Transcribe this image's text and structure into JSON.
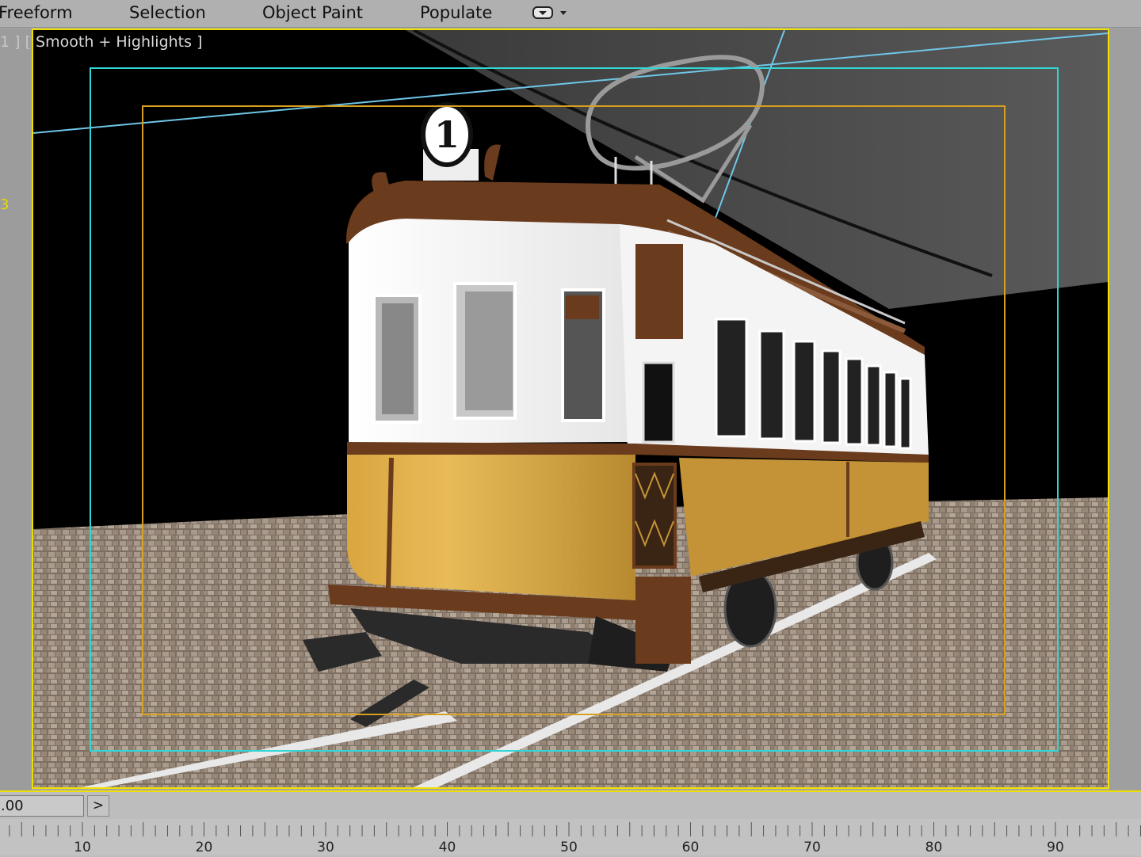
{
  "ribbon": {
    "tabs": [
      {
        "label": "Freeform"
      },
      {
        "label": "Selection"
      },
      {
        "label": "Object Paint"
      },
      {
        "label": "Populate"
      }
    ],
    "dropdown_icon": "display-dropdown-icon"
  },
  "viewport": {
    "label_prefix": "1 ] [",
    "shading_mode": "Smooth + Highlights ]",
    "active_border_color": "#f0e000",
    "safe_frame_outer_color": "#33d6d6",
    "safe_frame_inner_color": "#d8a020",
    "scene": {
      "tram_number": "1",
      "tram_upper_color": "#f2f2f2",
      "tram_lower_color": "#e0ad45",
      "tram_trim_color": "#6a3b1c"
    }
  },
  "left_strip": {
    "mark": "3"
  },
  "timeline": {
    "current_frame": ".00",
    "next_button": ">",
    "ticks": [
      "10",
      "20",
      "30",
      "40",
      "50",
      "60",
      "70",
      "80",
      "90"
    ]
  }
}
